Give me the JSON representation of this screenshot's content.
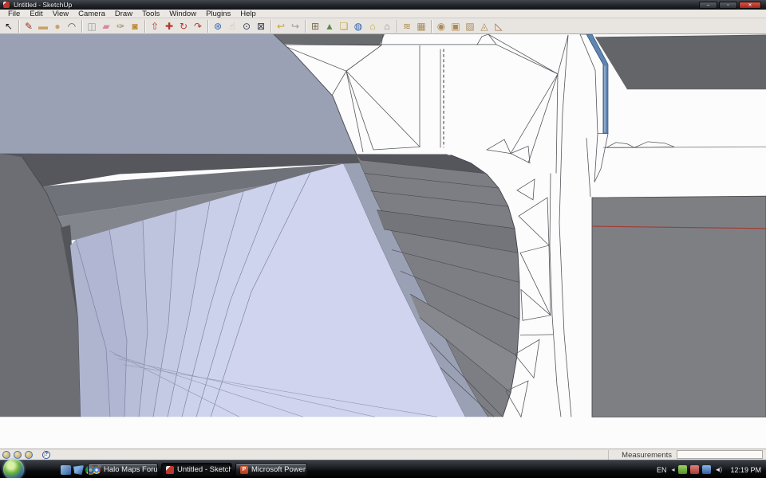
{
  "window": {
    "title": "Untitled - SketchUp",
    "controls": {
      "minimize": "–",
      "maximize": "▫",
      "close": "✕"
    }
  },
  "menubar": {
    "items": [
      {
        "name": "menu-file",
        "label": "File"
      },
      {
        "name": "menu-edit",
        "label": "Edit"
      },
      {
        "name": "menu-view",
        "label": "View"
      },
      {
        "name": "menu-camera",
        "label": "Camera"
      },
      {
        "name": "menu-draw",
        "label": "Draw"
      },
      {
        "name": "menu-tools",
        "label": "Tools"
      },
      {
        "name": "menu-window",
        "label": "Window"
      },
      {
        "name": "menu-plugins",
        "label": "Plugins"
      },
      {
        "name": "menu-help",
        "label": "Help"
      }
    ]
  },
  "toolbar": {
    "tools": [
      {
        "name": "select-tool",
        "char": "↖",
        "color": "#1a1a1a"
      },
      {
        "name": "line-tool",
        "char": "✎",
        "color": "#a33225",
        "sep": true
      },
      {
        "name": "rectangle-tool",
        "char": "▬",
        "color": "#c9a26b"
      },
      {
        "name": "circle-tool",
        "char": "●",
        "color": "#c9a26b"
      },
      {
        "name": "arc-tool",
        "char": "◠",
        "color": "#555555"
      },
      {
        "name": "make-component-tool",
        "char": "◫",
        "color": "#8f9a8f",
        "sep": true
      },
      {
        "name": "eraser-tool",
        "char": "▰",
        "color": "#d687a5"
      },
      {
        "name": "tape-measure-tool",
        "char": "✑",
        "color": "#8a7a55"
      },
      {
        "name": "paint-bucket-tool",
        "char": "◙",
        "color": "#b8862d"
      },
      {
        "name": "push-pull-tool",
        "char": "⇧",
        "color": "#b5372b",
        "sep": true
      },
      {
        "name": "move-tool",
        "char": "✚",
        "color": "#b5372b"
      },
      {
        "name": "rotate-tool",
        "char": "↻",
        "color": "#b5372b"
      },
      {
        "name": "offset-tool",
        "char": "↷",
        "color": "#b5372b"
      },
      {
        "name": "orbit-tool",
        "char": "⊛",
        "color": "#2d63b0",
        "sep": true
      },
      {
        "name": "pan-tool",
        "char": "☝",
        "color": "#c9a884"
      },
      {
        "name": "zoom-tool",
        "char": "⊙",
        "color": "#3a3f55"
      },
      {
        "name": "zoom-extents-tool",
        "char": "⊠",
        "color": "#3a3f55"
      },
      {
        "name": "previous-view-tool",
        "char": "↩",
        "color": "#c2a238",
        "sep": true
      },
      {
        "name": "next-view-tool",
        "char": "↪",
        "color": "#9a9a9a"
      },
      {
        "name": "get-current-view-tool",
        "char": "⊞",
        "color": "#7a6a4a",
        "sep": true
      },
      {
        "name": "toggle-terrain-tool",
        "char": "▲",
        "color": "#5f8c4a"
      },
      {
        "name": "photo-textures-tool",
        "char": "❏",
        "color": "#c9a23a"
      },
      {
        "name": "preview-google-earth-tool",
        "char": "◍",
        "color": "#2d63b0"
      },
      {
        "name": "get-models-tool",
        "char": "⌂",
        "color": "#c9a23a"
      },
      {
        "name": "share-models-tool",
        "char": "⌂",
        "color": "#8a8a8a"
      },
      {
        "name": "sandbox-from-contours-tool",
        "char": "≋",
        "color": "#ad8a55",
        "sep": true
      },
      {
        "name": "sandbox-from-scratch-tool",
        "char": "▦",
        "color": "#ad8a55"
      },
      {
        "name": "smoove-tool",
        "char": "◉",
        "color": "#ad8a55",
        "sep": true
      },
      {
        "name": "stamp-tool",
        "char": "▣",
        "color": "#ad8a55"
      },
      {
        "name": "drape-tool",
        "char": "▨",
        "color": "#ad8a55"
      },
      {
        "name": "add-detail-tool",
        "char": "◬",
        "color": "#ad8a55"
      },
      {
        "name": "flip-edge-tool",
        "char": "◺",
        "color": "#a56a45"
      }
    ]
  },
  "statusbar": {
    "left_icons": [
      {
        "name": "status-coin-1",
        "char": ""
      },
      {
        "name": "status-coin-2",
        "char": ""
      },
      {
        "name": "status-coin-3",
        "char": ""
      },
      {
        "name": "help-icon",
        "char": "?",
        "cls": "help"
      }
    ],
    "measurements_label": "Measurements",
    "measurements_value": ""
  },
  "taskbar": {
    "overflow_char": "»",
    "quicklaunch": [
      {
        "name": "quicklaunch-icon-1",
        "cls": "ql1"
      },
      {
        "name": "quicklaunch-icon-2",
        "cls": "ql2"
      },
      {
        "name": "quicklaunch-chrome-icon",
        "cls": "ql3"
      }
    ],
    "buttons": [
      {
        "name": "taskbar-button-halo-maps",
        "label": "Halo Maps Forum - ...",
        "icon": "chrome",
        "cls": "btn-halo"
      },
      {
        "name": "taskbar-button-sketchup",
        "label": "Untitled - SketchUp",
        "icon": "sketchup",
        "cls": "btn-su active"
      },
      {
        "name": "taskbar-button-powerpoint",
        "label": "Microsoft PowerPoi...",
        "icon": "powerpoint",
        "iconChar": "P",
        "cls": "btn-ppt"
      }
    ],
    "tray": {
      "language": "EN",
      "expand_char": "◂",
      "icons": [
        {
          "name": "tray-icon-green",
          "cls": "tr-green"
        },
        {
          "name": "tray-icon-red",
          "cls": "tr-red"
        },
        {
          "name": "tray-icon-network",
          "cls": "tr-blue"
        },
        {
          "name": "tray-icon-speaker",
          "cls": "tr-speaker",
          "char": "◄)"
        }
      ],
      "time": "12:19 PM"
    }
  },
  "colors": {
    "slate_plane": "#9ba1b5",
    "lavender_face": "#d0d4ef",
    "model_gray": "#7d7e84",
    "panel_gray": "#7e7f83",
    "edge_blue": "#5f85b2",
    "edge_red": "#a33a31"
  }
}
